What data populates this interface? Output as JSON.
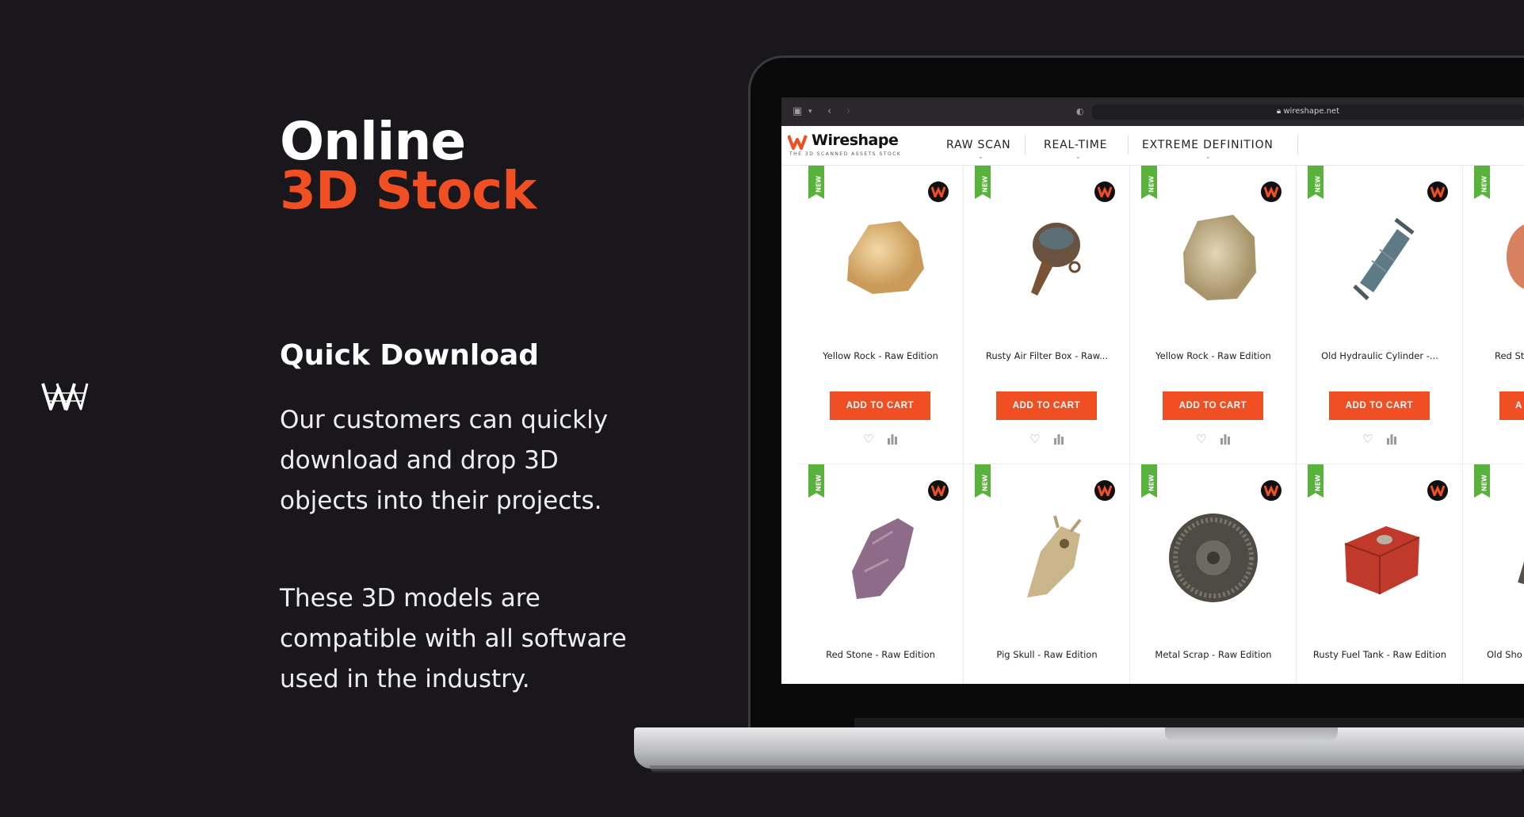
{
  "hero": {
    "line1": "Online",
    "line2": "3D Stock"
  },
  "section": {
    "title": "Quick Download",
    "paragraph1": "Our customers can quickly download and drop 3D objects into their projects.",
    "paragraph2": "These 3D models are compatible with all software used in the industry."
  },
  "colors": {
    "accent": "#f04e23",
    "background": "#19171b",
    "new_ribbon": "#58b23b"
  },
  "browser": {
    "url": "wireshape.net"
  },
  "site": {
    "logo_text": "Wireshape",
    "tagline": "THE 3D SCANNED ASSETS STOCK",
    "nav": [
      {
        "label": "RAW SCAN"
      },
      {
        "label": "REAL-TIME"
      },
      {
        "label": "EXTREME DEFINITION"
      }
    ]
  },
  "products": [
    {
      "name": "Yellow Rock - Raw Edition",
      "badge": "NEW",
      "cart": "ADD TO CART"
    },
    {
      "name": "Rusty Air Filter Box - Raw...",
      "badge": "NEW",
      "cart": "ADD TO CART"
    },
    {
      "name": "Yellow Rock - Raw Edition",
      "badge": "NEW",
      "cart": "ADD TO CART"
    },
    {
      "name": "Old Hydraulic Cylinder -...",
      "badge": "NEW",
      "cart": "ADD TO CART"
    },
    {
      "name": "Red St",
      "badge": "NEW",
      "cart": "A"
    },
    {
      "name": "Red Stone - Raw Edition",
      "badge": "NEW"
    },
    {
      "name": "Pig Skull - Raw Edition",
      "badge": "NEW"
    },
    {
      "name": "Metal Scrap - Raw Edition",
      "badge": "NEW"
    },
    {
      "name": "Rusty Fuel Tank - Raw Edition",
      "badge": "NEW"
    },
    {
      "name": "Old Sho",
      "badge": "NEW"
    }
  ]
}
